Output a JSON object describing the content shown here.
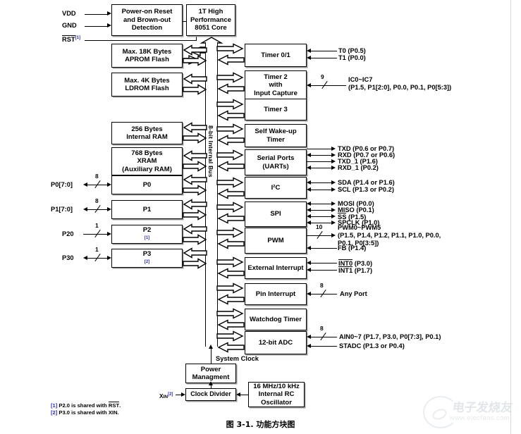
{
  "figure": {
    "caption": "图 3-1. 功能方块图",
    "bus_label": "8-bit Internal Bus",
    "system_clock_label": "System Clock"
  },
  "watermark": {
    "cn": "电子发烧友",
    "url": "www.elecfans.com"
  },
  "power_inputs": [
    {
      "name": "vdd",
      "label": "VDD"
    },
    {
      "name": "gnd",
      "label": "GND"
    },
    {
      "name": "rst",
      "label": "RST",
      "note": "[1]",
      "overline": true
    }
  ],
  "top_blocks": [
    {
      "name": "power-on-reset",
      "lines": [
        "Power-on Reset",
        "and Brown-out",
        "Detection"
      ]
    },
    {
      "name": "cpu-core",
      "lines": [
        "1T High",
        "Performance",
        "8051 Core"
      ]
    }
  ],
  "memory_blocks": [
    {
      "name": "aprom-flash",
      "lines": [
        "Max. 18K Bytes",
        "APROM Flash"
      ]
    },
    {
      "name": "ldrom-flash",
      "lines": [
        "Max. 4K Bytes",
        "LDROM Flash"
      ]
    },
    {
      "name": "internal-ram",
      "lines": [
        "256 Bytes",
        "Internal RAM"
      ]
    },
    {
      "name": "xram",
      "lines": [
        "768 Bytes",
        "XRAM",
        "(Auxiliary RAM)"
      ]
    }
  ],
  "port_blocks": [
    {
      "name": "port-p0",
      "label": "P0",
      "note": "",
      "pin_label": "P0[7:0]",
      "width": "8",
      "bidir": true
    },
    {
      "name": "port-p1",
      "label": "P1",
      "note": "",
      "pin_label": "P1[7:0]",
      "width": "8",
      "bidir": true
    },
    {
      "name": "port-p2",
      "label": "P2",
      "note": "[1]",
      "pin_label": "P20",
      "width": "1",
      "bidir": false
    },
    {
      "name": "port-p3",
      "label": "P3",
      "note": "[2]",
      "pin_label": "P30",
      "width": "1",
      "bidir": true
    }
  ],
  "peripherals": [
    {
      "name": "timer-0-1",
      "lines": [
        "Timer 0/1"
      ],
      "signals": [
        {
          "text": "T0 (P0.5)",
          "dir": "in"
        },
        {
          "text": "T1 (P0.0)",
          "dir": "in"
        }
      ]
    },
    {
      "name": "timer-2-input-capture",
      "lines": [
        "Timer 2",
        "with",
        "Input Capture"
      ],
      "bus_width": "9",
      "signals": [
        {
          "text": "IC0~IC7",
          "text2": "(P1.5, P1[2:0], P0.0, P0.1, P0[5:3])",
          "dir": "in"
        }
      ]
    },
    {
      "name": "timer-3",
      "lines": [
        "Timer 3"
      ],
      "signals": []
    },
    {
      "name": "self-wake-up-timer",
      "lines": [
        "Self Wake-up",
        "Timer"
      ],
      "signals": []
    },
    {
      "name": "serial-ports-uarts",
      "lines": [
        "Serial Ports",
        "(UARTs)"
      ],
      "signals": [
        {
          "text": "TXD (P0.6 or P0.7)",
          "dir": "out"
        },
        {
          "text": "RXD (P0.7 or P0.6)",
          "dir": "in"
        },
        {
          "text": "TXD_1 (P1.6)",
          "dir": "out"
        },
        {
          "text": "RXD_1 (P0.2)",
          "dir": "in"
        }
      ]
    },
    {
      "name": "i2c",
      "lines": [
        "I²C"
      ],
      "signals": [
        {
          "text": "SDA (P1.4 or P1.6)",
          "dir": "bidir"
        },
        {
          "text": "SCL (P1.3 or P0.2)",
          "dir": "bidir"
        }
      ]
    },
    {
      "name": "spi",
      "lines": [
        "SPI"
      ],
      "signals": [
        {
          "text": "MOSI (P0.0)",
          "dir": "out"
        },
        {
          "text": "MISO (P0.1)",
          "dir": "in"
        },
        {
          "text": "SS (P1.5)",
          "dir": "bidir",
          "overline": true
        },
        {
          "text": "SPCLK (P1.0)",
          "dir": "bidir"
        }
      ]
    },
    {
      "name": "pwm",
      "lines": [
        "PWM"
      ],
      "bus_width": "10",
      "signals": [
        {
          "text": "PWM0~PWM5",
          "text2": "(P1.5, P1.4, P1.2, P1.1, P1.0, P0.0,",
          "text3": "P0.1, P0[3:5])",
          "dir": "out"
        },
        {
          "text": "FB (P1.4)",
          "dir": "in"
        }
      ]
    },
    {
      "name": "external-interrupt",
      "lines": [
        "External Interrupt"
      ],
      "signals": [
        {
          "text": "INT0 (P3.0)",
          "dir": "in",
          "overline": "INT0"
        },
        {
          "text": "INT1 (P1.7)",
          "dir": "in",
          "overline": "INT1"
        }
      ]
    },
    {
      "name": "pin-interrupt",
      "lines": [
        "Pin Interrupt"
      ],
      "bus_width": "8",
      "signals": [
        {
          "text": "Any Port",
          "dir": "in"
        }
      ]
    },
    {
      "name": "watchdog-timer",
      "lines": [
        "Watchdog Timer"
      ],
      "signals": []
    },
    {
      "name": "adc-12bit",
      "lines": [
        "12-bit ADC"
      ],
      "bus_width": "8",
      "signals": [
        {
          "text": "AIN0~7 (P1.7, P3.0, P0[7:3],  P0.1)",
          "dir": "in"
        },
        {
          "text": "STADC (P1.3 or P0.4)",
          "dir": "in"
        }
      ]
    }
  ],
  "clock_section": {
    "power_management": [
      "Power",
      "Managment"
    ],
    "clock_divider": [
      "Clock Divider"
    ],
    "oscillator": [
      "16 MHz/10 kHz",
      "Internal RC",
      "Oscillator"
    ],
    "xin_label": "XIN",
    "xin_note": "[2]"
  },
  "footnotes": [
    {
      "marker": "[1]",
      "pre": "P2.0 is shared with ",
      "overlined": "RST",
      "post": "."
    },
    {
      "marker": "[2]",
      "pre": "P3.0 is shared with ",
      "overlined": "",
      "post": "XIN."
    }
  ]
}
